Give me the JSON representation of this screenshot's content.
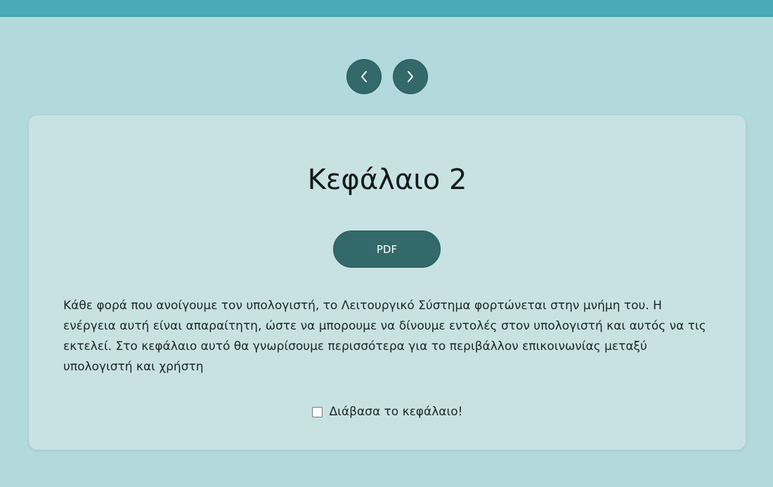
{
  "header": {
    "bar_color": "#4aaab5"
  },
  "nav": {
    "prev_icon": "chevron-left-icon",
    "next_icon": "chevron-right-icon",
    "button_color": "#33696a"
  },
  "card": {
    "title": "Κεφάλαιο 2",
    "pdf_label": "PDF",
    "description": "Κάθε φορά που ανοίγουμε τον υπολογιστή, το Λειτουργικό Σύστημα φορτώνεται στην μνήμη του. Η ενέργεια αυτή είναι απαραίτητη, ώστε να μπορουμε να δίνουμε εντολές στον υπολογιστή και αυτός να τις εκτελεί. Στο κεφάλαιο αυτό θα γνωρίσουμε περισσότερα για το περιβάλλον επικοινωνίας μεταξύ υπολογιστή και χρήστη",
    "read_checkbox_label": "Διάβασα το κεφάλαιο!",
    "read_checked": false
  },
  "colors": {
    "page_background": "#b2dadd",
    "card_background": "#c8e2e4",
    "accent": "#33696a"
  }
}
